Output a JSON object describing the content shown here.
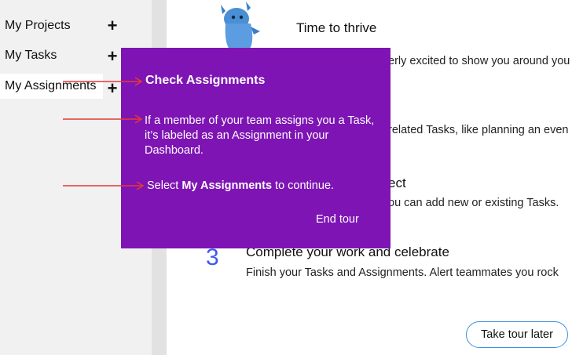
{
  "sidebar": {
    "items": [
      {
        "label": "My Projects",
        "add": "+"
      },
      {
        "label": "My Tasks",
        "add": "+"
      },
      {
        "label": "My Assignments",
        "add": "+"
      }
    ]
  },
  "main": {
    "heading": "Time to thrive",
    "intro_fragment": "erly excited to show you around you",
    "tasks_fragment": "related Tasks, like planning an even",
    "project_title_fragment": "ect",
    "project_desc_fragment": "ou can add new or existing Tasks.",
    "step3": {
      "number": "3",
      "title": "Complete your work and celebrate",
      "desc": "Finish your Tasks and Assignments. Alert teammates you rock"
    },
    "tour_later_label": "Take tour later"
  },
  "tour": {
    "title": "Check Assignments",
    "description": "If a member of your team assigns you a Task, it’s labeled as an Assignment in your Dashboard.",
    "cta_prefix": "Select ",
    "cta_bold": "My Assignments",
    "cta_suffix": " to continue.",
    "end_label": "End tour"
  },
  "colors": {
    "tour_background": "#7e14b4",
    "accent_blue": "#3d5af1",
    "annotation_red": "#e53935"
  }
}
